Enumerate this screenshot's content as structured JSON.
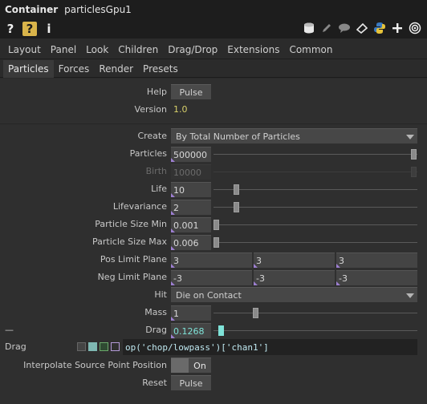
{
  "window": {
    "type": "Container",
    "name": "particlesGpu1"
  },
  "tabs_top": [
    "Layout",
    "Panel",
    "Look",
    "Children",
    "Drag/Drop",
    "Extensions",
    "Common"
  ],
  "tabs_sub": [
    "Particles",
    "Forces",
    "Render",
    "Presets"
  ],
  "active_sub_tab": "Particles",
  "params": {
    "help": {
      "label": "Help",
      "button": "Pulse"
    },
    "version": {
      "label": "Version",
      "value": "1.0"
    },
    "create": {
      "label": "Create",
      "value": "By Total Number of Particles"
    },
    "particles": {
      "label": "Particles",
      "value": "500000",
      "fraction": 1.0
    },
    "birth": {
      "label": "Birth",
      "value": "10000",
      "fraction": 1.0
    },
    "life": {
      "label": "Life",
      "value": "10",
      "fraction": 0.1
    },
    "lifevariance": {
      "label": "Lifevariance",
      "value": "2",
      "fraction": 0.1
    },
    "psize_min": {
      "label": "Particle Size Min",
      "value": "0.001",
      "fraction": 0.0
    },
    "psize_max": {
      "label": "Particle Size Max",
      "value": "0.006",
      "fraction": 0.0
    },
    "pos_limit": {
      "label": "Pos Limit Plane",
      "values": [
        "3",
        "3",
        "3"
      ]
    },
    "neg_limit": {
      "label": "Neg Limit Plane",
      "values": [
        "-3",
        "-3",
        "-3"
      ]
    },
    "hit": {
      "label": "Hit",
      "value": "Die on Contact"
    },
    "mass": {
      "label": "Mass",
      "value": "1",
      "fraction": 0.2
    },
    "drag": {
      "label": "Drag",
      "value": "0.1268",
      "fraction": 0.01
    },
    "drag_expr": {
      "label": "Drag",
      "expression": "op('chop/lowpass')['chan1']"
    },
    "interp": {
      "label": "Interpolate Source Point Position",
      "value": "On"
    },
    "reset": {
      "label": "Reset",
      "button": "Pulse"
    }
  },
  "colors": {
    "accent": "#7fe3d8",
    "version": "#d8d06a",
    "mark": "#9d7fd1"
  }
}
